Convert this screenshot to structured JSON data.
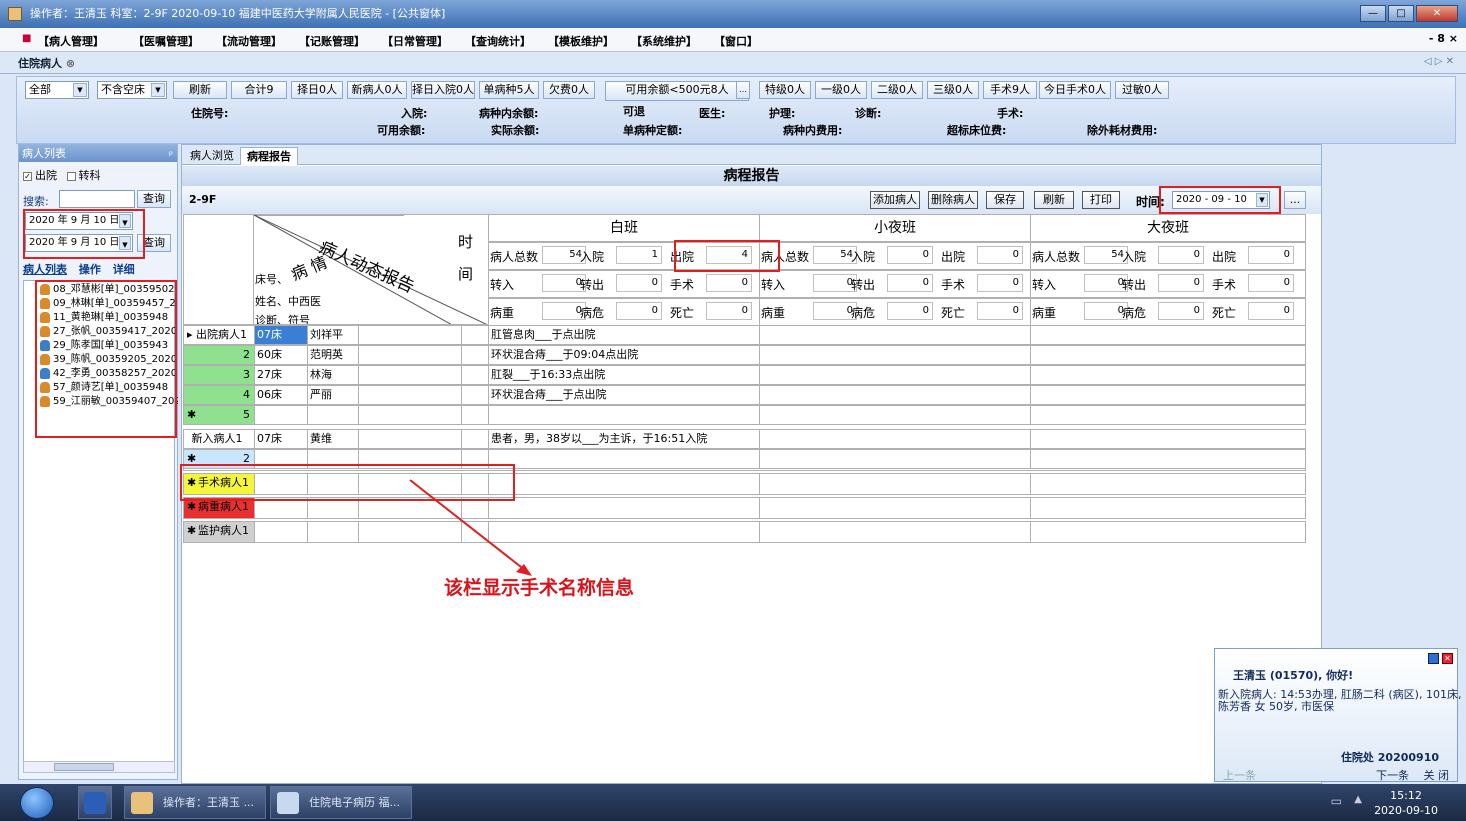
{
  "window": {
    "title": "操作者：王清玉  科室：2-9F  2020-09-10  福建中医药大学附属人民医院 - [公共窗体]"
  },
  "menu": [
    "【病人管理】",
    "【医嘱管理】",
    "【流动管理】",
    "【记账管理】",
    "【日常管理】",
    "【查询统计】",
    "【模板维护】",
    "【系统维护】",
    "【窗口】"
  ],
  "mdi_controls": "- 8 ×",
  "doc_tab": "住院病人",
  "toolbar": {
    "filter1": "全部",
    "filter2": "不含空床",
    "buttons": [
      "刷新",
      "合计9",
      "择日0人",
      "新病人0人",
      "择日入院0人",
      "单病种5人",
      "欠费0人",
      "可用余额<500元8人",
      "特级0人",
      "一级0人",
      "二级0人",
      "三级0人",
      "手术9人",
      "今日手术0人",
      "过敏0人"
    ],
    "row1_labels": [
      "住院号:",
      "入院:",
      "病种内余额:",
      "可退",
      "医生:",
      "护理:",
      "诊断:",
      "手术:"
    ],
    "row2_labels": [
      "可用余额:",
      "实际余额:",
      "单病种定额:",
      "病种内费用:",
      "超标床位费:",
      "除外耗材费用:"
    ]
  },
  "left": {
    "title": "病人列表",
    "chk_discharge": "出院",
    "chk_transfer": "转科",
    "search_label": "搜索:",
    "query": "查询",
    "date1": "2020 年 9 月 10 日",
    "date2": "2020 年 9 月 10 日",
    "tabs": [
      "病人列表",
      "操作",
      "详细"
    ],
    "patients": [
      {
        "text": "08_邓慧彬[单]_00359502"
      },
      {
        "text": "09_林琳[单]_00359457_2"
      },
      {
        "text": "11_黄艳琳[单]_0035948"
      },
      {
        "text": "27_张帆_00359417_2020"
      },
      {
        "text": "29_陈孝国[单]_0035943"
      },
      {
        "text": "39_陈帆_00359205_2020"
      },
      {
        "text": "42_李勇_00358257_2020"
      },
      {
        "text": "57_颜诗艺[单]_0035948"
      },
      {
        "text": "59_江丽敏_00359407_202"
      }
    ]
  },
  "subtabs": [
    "病人浏览",
    "病程报告"
  ],
  "report": {
    "title": "病程报告",
    "ward": "2-9F",
    "actions": [
      "添加病人",
      "删除病人",
      "保存",
      "刷新",
      "打印"
    ],
    "time_label": "时间:",
    "time_value": "2020 - 09 - 10",
    "more": "...",
    "diag_top": "病人动态报告",
    "diag_mid": "病 情",
    "diag_time1": "时",
    "diag_time2": "间",
    "diag_lines": [
      "床号、",
      "姓名、中西医",
      "诊断、符号"
    ],
    "shifts": [
      "白班",
      "小夜班",
      "大夜班"
    ],
    "stat_labels": [
      [
        "病人总数",
        "入院",
        "出院"
      ],
      [
        "转入",
        "转出",
        "手术"
      ],
      [
        "病重",
        "病危",
        "死亡"
      ]
    ],
    "stats": [
      [
        [
          54,
          1,
          4
        ],
        [
          0,
          0,
          0
        ],
        [
          0,
          0,
          0
        ]
      ],
      [
        [
          54,
          0,
          0
        ],
        [
          0,
          0,
          0
        ],
        [
          0,
          0,
          0
        ]
      ],
      [
        [
          54,
          0,
          0
        ],
        [
          0,
          0,
          0
        ],
        [
          0,
          0,
          0
        ]
      ]
    ],
    "discharge_label": "出院病人1",
    "discharge_rows": [
      {
        "n": "",
        "bed": "07床",
        "name": "刘祥平",
        "note": "肛管息肉___于点出院"
      },
      {
        "n": "2",
        "bed": "60床",
        "name": "范明英",
        "note": "环状混合痔___于09:04点出院"
      },
      {
        "n": "3",
        "bed": "27床",
        "name": "林海",
        "note": "肛裂___于16:33点出院"
      },
      {
        "n": "4",
        "bed": "06床",
        "name": "严丽",
        "note": "环状混合痔___于点出院"
      },
      {
        "n": "5",
        "bed": "",
        "name": "",
        "note": ""
      }
    ],
    "new_label": "新入病人1",
    "new_rows": [
      {
        "n": "",
        "bed": "07床",
        "name": "黄维",
        "note": "患者，男，38岁以___为主诉，于16:51入院"
      },
      {
        "n": "2",
        "bed": "",
        "name": "",
        "note": ""
      }
    ],
    "surgery_label": "手术病人1",
    "critical_label": "病重病人1",
    "monitor_label": "监护病人1"
  },
  "annotation": "该栏显示手术名称信息",
  "notify": {
    "greeting": "王清玉 (01570), 你好!",
    "msg1": "新入院病人: 14:53办理, 肛肠二科 (病区), 101床,",
    "msg2": "陈芳香 女 50岁, 市医保",
    "sign": "住院处  20200910",
    "prev": "上一条",
    "next": "下一条",
    "close": "关 闭"
  },
  "taskbar": {
    "items": [
      "操作者：王清玉 ...",
      "住院电子病历  福..."
    ],
    "time": "15:12",
    "date": "2020-09-10"
  },
  "colors": {
    "green": "#8fe08f",
    "yellow": "#f5f53a",
    "red": "#e83030",
    "annot": "#d8141a"
  }
}
